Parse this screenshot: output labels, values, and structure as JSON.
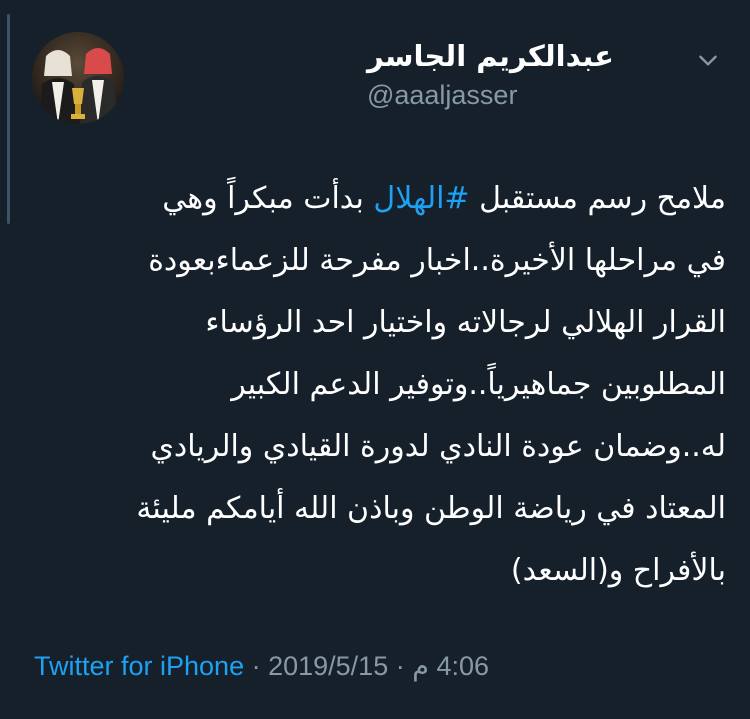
{
  "user": {
    "display_name": "عبدالكريم الجاسر",
    "handle": "@aaaljasser"
  },
  "tweet": {
    "lines": [
      {
        "before": "ملامح رسم مستقبل ",
        "hashtag": "#الهلال",
        "after": " بدأت مبكراً وهي"
      },
      {
        "text": "في مراحلها الأخيرة..اخبار مفرحة للزعماءبعودة"
      },
      {
        "text": "القرار الهلالي لرجالاته واختيار احد الرؤساء"
      },
      {
        "text": "المطلوبين جماهيرياً..وتوفير الدعم الكبير"
      },
      {
        "text": "له..وضمان عودة النادي لدورة القيادي والريادي"
      },
      {
        "text": "المعتاد في رياضة الوطن وباذن الله أيامكم مليئة"
      },
      {
        "text": "بالأفراح و(السعد)"
      }
    ]
  },
  "meta": {
    "source": "Twitter for iPhone",
    "separator1": " · ",
    "date": "2019/5/15",
    "separator2": " · ",
    "time": "4:06 م"
  },
  "icons": {
    "menu": "chevron-down-icon",
    "avatar": "profile-photo"
  },
  "colors": {
    "background": "#15202b",
    "text": "#ffffff",
    "secondary": "#8899a6",
    "accent": "#1da1f2"
  }
}
